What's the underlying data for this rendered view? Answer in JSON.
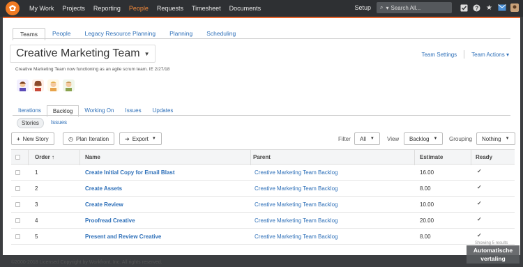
{
  "topbar": {
    "nav": [
      "My Work",
      "Projects",
      "Reporting",
      "People",
      "Requests",
      "Timesheet",
      "Documents"
    ],
    "active_nav": "People",
    "setup": "Setup",
    "search_placeholder": "Search All...",
    "icons": [
      "checklist-icon",
      "help-icon",
      "star-icon",
      "email-icon",
      "user-avatar-icon"
    ]
  },
  "page_tabs": {
    "items": [
      "Teams",
      "People",
      "Legacy Resource Planning",
      "Planning",
      "Scheduling"
    ],
    "active": "Teams"
  },
  "team": {
    "title": "Creative Marketing Team",
    "description": "Creative Marketing Team now functioning as an agile scrum team. IE 2/27/18",
    "settings_link": "Team Settings",
    "actions_link": "Team Actions ▾"
  },
  "sub_tabs": {
    "items": [
      "Iterations",
      "Backlog",
      "Working On",
      "Issues",
      "Updates"
    ],
    "active": "Backlog"
  },
  "pills": {
    "items": [
      "Stories",
      "Issues"
    ],
    "active": "Stories"
  },
  "toolbar": {
    "new_story": "New Story",
    "plan_iteration": "Plan Iteration",
    "export": "Export",
    "filter_label": "Filter",
    "filter_value": "All",
    "view_label": "View",
    "view_value": "Backlog",
    "grouping_label": "Grouping",
    "grouping_value": "Nothing"
  },
  "table": {
    "headers": {
      "order": "Order",
      "name": "Name",
      "parent": "Parent",
      "estimate": "Estimate",
      "ready": "Ready"
    },
    "rows": [
      {
        "order": "1",
        "name": "Create Initial Copy for Email Blast",
        "parent": "Creative Marketing Team Backlog",
        "estimate": "16.00",
        "ready": "✔"
      },
      {
        "order": "2",
        "name": "Create Assets",
        "parent": "Creative Marketing Team Backlog",
        "estimate": "8.00",
        "ready": "✔"
      },
      {
        "order": "3",
        "name": "Create Review",
        "parent": "Creative Marketing Team Backlog",
        "estimate": "10.00",
        "ready": "✔"
      },
      {
        "order": "4",
        "name": "Proofread Creative",
        "parent": "Creative Marketing Team Backlog",
        "estimate": "20.00",
        "ready": "✔"
      },
      {
        "order": "5",
        "name": "Present and Review Creative",
        "parent": "Creative Marketing Team Backlog",
        "estimate": "8.00",
        "ready": "✔"
      }
    ]
  },
  "footer": {
    "copyright": "©2000-2018 Licensed Copyright by Workfront, Inc. All rights reserved.",
    "watermark_top": "Showing 5 results",
    "badge_line1": "Automatische",
    "badge_line2": "vertaling"
  },
  "colors": {
    "accent": "#e8632a",
    "link": "#2d6fb8",
    "topbar": "#2e3033"
  }
}
